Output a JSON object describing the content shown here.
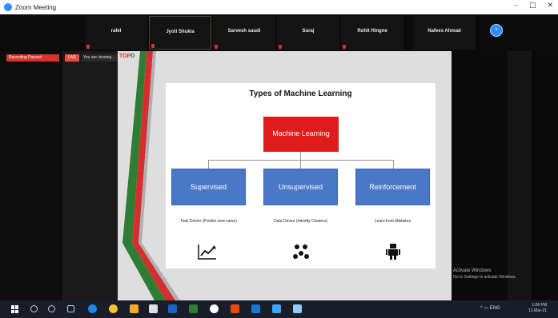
{
  "window": {
    "title": "Zoom Meeting"
  },
  "gallery": {
    "participants": [
      {
        "name": "rafel"
      },
      {
        "name": "Jyoti Shukla"
      },
      {
        "name": "Sarvesh saudi"
      },
      {
        "name": "Suraj"
      },
      {
        "name": "Rohit Hingne"
      },
      {
        "name": "Nafees Ahmad"
      }
    ],
    "next_icon": "chevron-right-icon"
  },
  "share_bar": {
    "sharing_label": "Recording Paused",
    "live_label": "LIVE",
    "viewing_label": "You are viewing..."
  },
  "slide": {
    "title": "Types of Machine Learning",
    "root_label": "Machine Learning",
    "types": [
      {
        "label": "Supervised",
        "desc": "Task Driven (Predict next value)",
        "icon": "trend-chart-icon"
      },
      {
        "label": "Unsupervised",
        "desc": "Data Driven (Identify Clusters)",
        "icon": "clusters-icon"
      },
      {
        "label": "Reinforcement",
        "desc": "Learn from Mistakes",
        "icon": "robot-icon"
      }
    ],
    "colors": {
      "root": "#e01b1b",
      "type_box": "#4a78c7"
    }
  },
  "logo": {
    "brand": "TOP",
    "accent": "D"
  },
  "watermark": {
    "line1": "Activate Windows",
    "line2": "Go to Settings to activate Windows."
  },
  "taskbar": {
    "time": "1:08 PM",
    "date": "11-Mar-21",
    "lang": "ENG"
  }
}
